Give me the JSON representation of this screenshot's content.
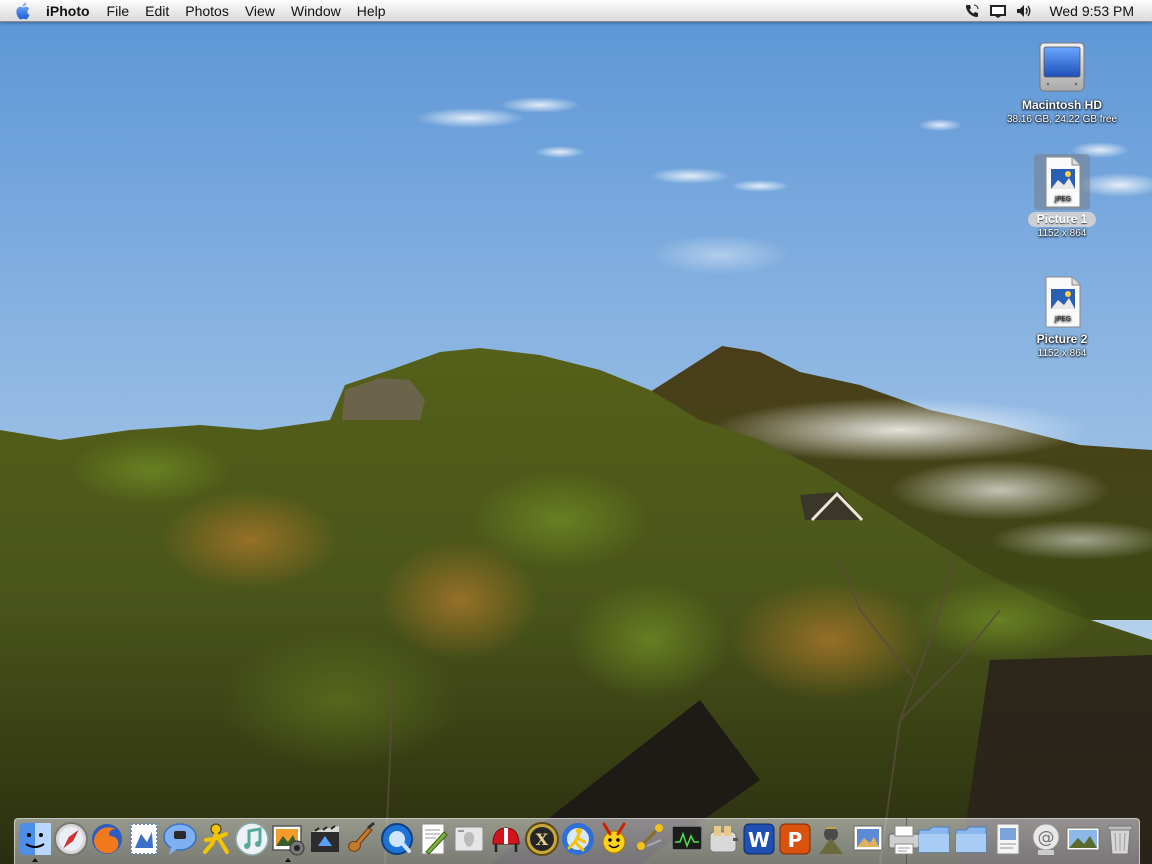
{
  "menubar": {
    "app_name": "iPhoto",
    "menus": [
      "File",
      "Edit",
      "Photos",
      "View",
      "Window",
      "Help"
    ],
    "extras": [
      "phone-icon",
      "display-icon",
      "volume-icon"
    ],
    "clock": "Wed 9:53 PM"
  },
  "desktop_icons": [
    {
      "name": "Macintosh HD",
      "subtitle": "38.16 GB, 24.22 GB free",
      "icon": "hard-drive-icon",
      "selected": false
    },
    {
      "name": "Picture 1",
      "subtitle": "1152 x 864",
      "icon": "jpeg-file-icon",
      "file_type": "JPEG",
      "selected": true
    },
    {
      "name": "Picture 2",
      "subtitle": "1152 x 864",
      "icon": "jpeg-file-icon",
      "file_type": "JPEG",
      "selected": false
    }
  ],
  "dock": {
    "apps": [
      {
        "icon": "finder-icon",
        "running": true
      },
      {
        "icon": "safari-icon",
        "running": false
      },
      {
        "icon": "firefox-icon",
        "running": false
      },
      {
        "icon": "mail-stamp-icon",
        "running": false
      },
      {
        "icon": "ichat-icon",
        "running": false
      },
      {
        "icon": "aim-icon",
        "running": false
      },
      {
        "icon": "itunes-icon",
        "running": false
      },
      {
        "icon": "iphoto-icon",
        "running": true
      },
      {
        "icon": "imovie-icon",
        "running": false
      },
      {
        "icon": "garageband-icon",
        "running": false
      },
      {
        "icon": "quicktime-icon",
        "running": false
      },
      {
        "icon": "textedit-icon",
        "running": false
      },
      {
        "icon": "system-profiler-icon",
        "running": false
      },
      {
        "icon": "lifeguard-icon",
        "running": false
      },
      {
        "icon": "osx-icon",
        "running": false
      },
      {
        "icon": "runner-icon",
        "running": false
      },
      {
        "icon": "yahoo-messenger-icon",
        "running": false
      },
      {
        "icon": "network-icon",
        "running": false
      },
      {
        "icon": "activity-monitor-icon",
        "running": false
      },
      {
        "icon": "toaster-icon",
        "running": false
      },
      {
        "icon": "word-icon",
        "running": false
      },
      {
        "icon": "powerpoint-icon",
        "running": false
      },
      {
        "icon": "graphic-icon",
        "running": false
      },
      {
        "icon": "preview-icon",
        "running": false
      },
      {
        "icon": "printer-icon",
        "running": false
      }
    ],
    "docs": [
      {
        "icon": "folder-icon"
      },
      {
        "icon": "folder-icon"
      },
      {
        "icon": "document-icon"
      },
      {
        "icon": "mail-at-icon"
      },
      {
        "icon": "picture-icon"
      },
      {
        "icon": "trash-icon"
      }
    ]
  },
  "colors": {
    "sky_top": "#5d97d8",
    "sky_bottom": "#d3e4f3",
    "forest_dark": "#2c3410",
    "forest_mid": "#4d5a19",
    "forest_autumn": "#8b6a22"
  }
}
